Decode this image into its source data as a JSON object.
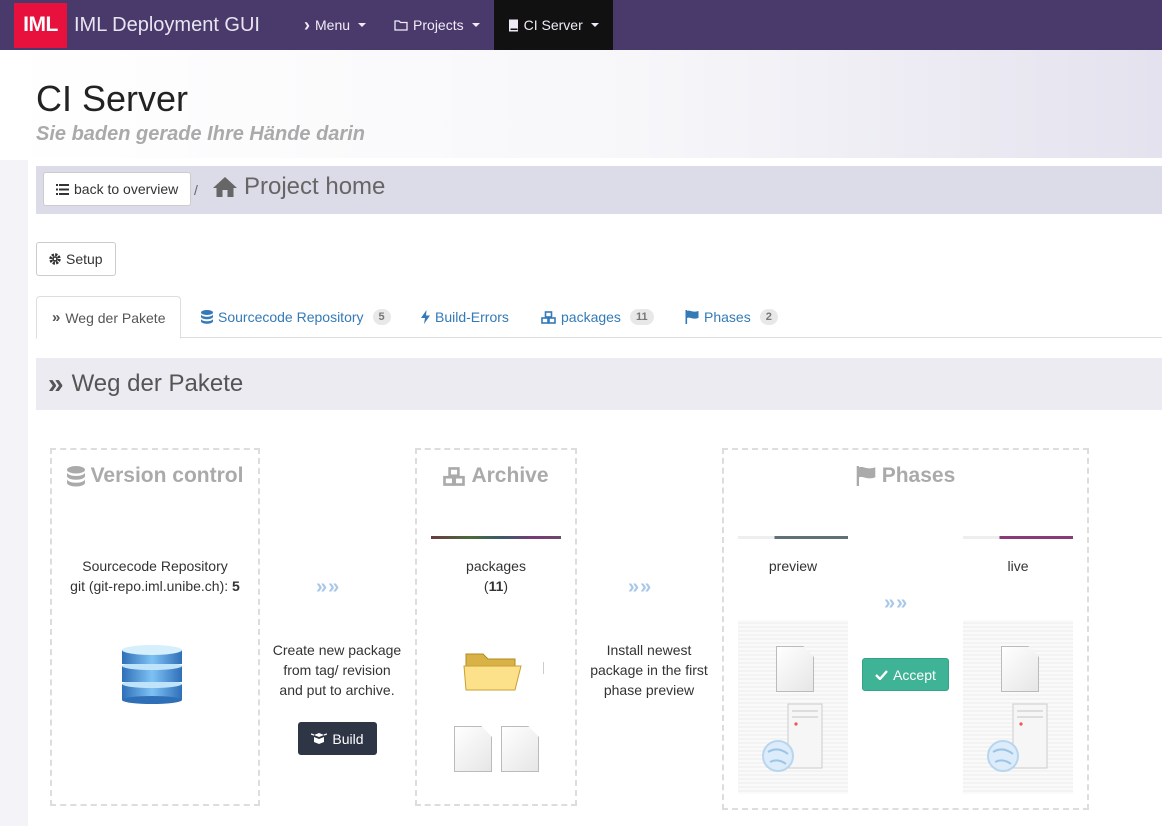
{
  "navbar": {
    "logo": "IML",
    "title": "IML Deployment GUI",
    "items": [
      {
        "label": "Menu",
        "icon": "chevron-right-icon",
        "glyph": "›"
      },
      {
        "label": "Projects",
        "icon": "folder-icon",
        "glyph": "🗀"
      },
      {
        "label": "CI Server",
        "icon": "book-icon",
        "glyph": "▆"
      }
    ]
  },
  "header": {
    "title": "CI Server",
    "subtitle": "Sie baden gerade Ihre Hände darin"
  },
  "breadcrumb": {
    "back_label": "back to overview",
    "separator": "/",
    "current": "Project home"
  },
  "setup_label": "Setup",
  "tabs": [
    {
      "label": "Weg der Pakete",
      "badge": ""
    },
    {
      "label": "Sourcecode Repository",
      "badge": "5"
    },
    {
      "label": "Build-Errors",
      "badge": ""
    },
    {
      "label": "packages",
      "badge": "11"
    },
    {
      "label": "Phases",
      "badge": "2"
    }
  ],
  "section": {
    "title": "Weg der Pakete"
  },
  "flow": {
    "version_control": {
      "title": "Version control",
      "line1": "Sourcecode Repository",
      "line2": "git (git-repo.iml.unibe.ch): ",
      "count": "5"
    },
    "step1": {
      "arrows": "»»",
      "line1": "Create new package",
      "line2": "from tag/ revision",
      "line3": "and put to archive.",
      "button": "Build"
    },
    "archive": {
      "title": "Archive",
      "label": "packages",
      "count_open": "(",
      "count": "11",
      "count_close": ")"
    },
    "step2": {
      "arrows": "»»",
      "line1": "Install newest",
      "line2": "package in the first",
      "line3": "phase preview"
    },
    "phases": {
      "title": "Phases",
      "preview": "preview",
      "live": "live",
      "arrows": "»»",
      "accept": "Accept"
    }
  },
  "colors": {
    "navbar": "#4a3a6b",
    "logo": "#e8103c",
    "link": "#337ab7",
    "accept": "#3fb395",
    "dark_button": "#2e3545"
  }
}
